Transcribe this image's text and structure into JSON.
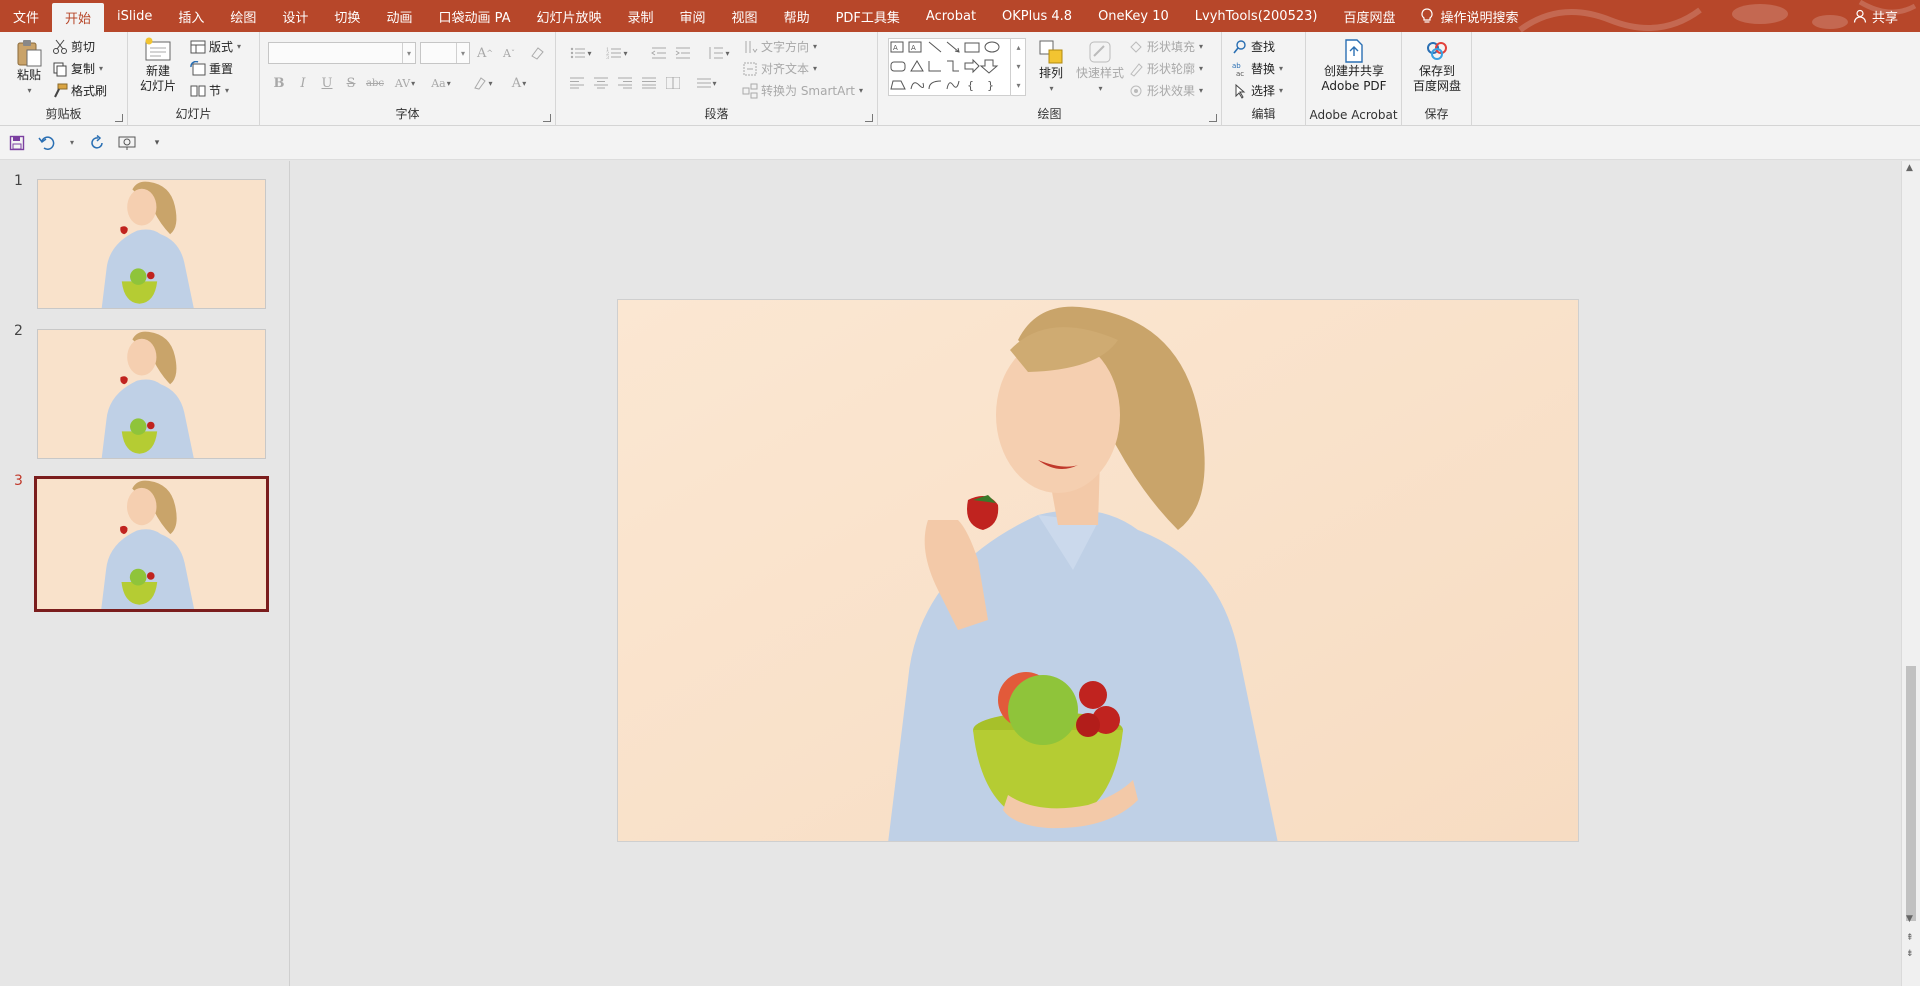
{
  "tabs": [
    {
      "label": "文件",
      "active": false
    },
    {
      "label": "开始",
      "active": true
    },
    {
      "label": "iSlide",
      "active": false
    },
    {
      "label": "插入",
      "active": false
    },
    {
      "label": "绘图",
      "active": false
    },
    {
      "label": "设计",
      "active": false
    },
    {
      "label": "切换",
      "active": false
    },
    {
      "label": "动画",
      "active": false
    },
    {
      "label": "口袋动画 PA",
      "active": false
    },
    {
      "label": "幻灯片放映",
      "active": false
    },
    {
      "label": "录制",
      "active": false
    },
    {
      "label": "审阅",
      "active": false
    },
    {
      "label": "视图",
      "active": false
    },
    {
      "label": "帮助",
      "active": false
    },
    {
      "label": "PDF工具集",
      "active": false
    },
    {
      "label": "Acrobat",
      "active": false
    },
    {
      "label": "OKPlus 4.8",
      "active": false
    },
    {
      "label": "OneKey 10",
      "active": false
    },
    {
      "label": "LvyhTools(200523)",
      "active": false
    },
    {
      "label": "百度网盘",
      "active": false
    }
  ],
  "tell_me": "操作说明搜索",
  "share": "共享",
  "ribbon": {
    "clipboard": {
      "label": "剪贴板",
      "paste": "粘贴",
      "cut": "剪切",
      "copy": "复制",
      "format_painter": "格式刷"
    },
    "slides": {
      "label": "幻灯片",
      "new_slide_l1": "新建",
      "new_slide_l2": "幻灯片",
      "layout": "版式",
      "reset": "重置",
      "section": "节"
    },
    "font": {
      "label": "字体",
      "bold": "B",
      "italic": "I",
      "underline": "U",
      "shadow": "S",
      "strike": "abc",
      "spacing": "AV",
      "case": "Aa",
      "grow": "A",
      "shrink": "A",
      "color": "A"
    },
    "paragraph": {
      "label": "段落",
      "text_direction": "文字方向",
      "align_text": "对齐文本",
      "smartart": "转换为 SmartArt"
    },
    "drawing": {
      "label": "绘图",
      "arrange": "排列",
      "quick_styles": "快速样式",
      "fill": "形状填充",
      "outline": "形状轮廓",
      "effects": "形状效果"
    },
    "editing": {
      "label": "编辑",
      "find": "查找",
      "replace": "替换",
      "select": "选择"
    },
    "acrobat": {
      "label": "Adobe Acrobat",
      "create_l1": "创建并共享",
      "create_l2": "Adobe PDF"
    },
    "save": {
      "label": "保存",
      "btn_l1": "保存到",
      "btn_l2": "百度网盘"
    }
  },
  "slides": [
    {
      "number": "1",
      "selected": false
    },
    {
      "number": "2",
      "selected": false
    },
    {
      "number": "3",
      "selected": true
    }
  ],
  "colors": {
    "accent": "#b7472a",
    "selected_border": "#7b1d1d",
    "slide_bg": "#f9e3cd"
  }
}
